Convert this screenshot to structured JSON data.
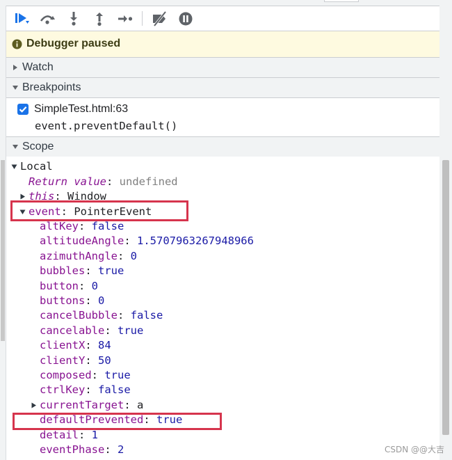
{
  "toolbar": {
    "buttons": [
      {
        "name": "resume-icon",
        "color": "#1a73e8"
      },
      {
        "name": "step-over-icon",
        "color": "#5f6368"
      },
      {
        "name": "step-into-icon",
        "color": "#5f6368"
      },
      {
        "name": "step-out-icon",
        "color": "#5f6368"
      },
      {
        "name": "step-icon",
        "color": "#5f6368"
      },
      {
        "name": "deactivate-breakpoints-icon",
        "color": "#5f6368"
      },
      {
        "name": "pause-on-exceptions-icon",
        "color": "#5f6368"
      }
    ]
  },
  "banner": {
    "text": "Debugger paused",
    "icon": "info-icon",
    "background": "#fefae0"
  },
  "sections": {
    "watch": {
      "label": "Watch",
      "expanded": false
    },
    "breakpoints": {
      "label": "Breakpoints",
      "expanded": true
    },
    "scope": {
      "label": "Scope",
      "expanded": true
    }
  },
  "breakpoint": {
    "checked": true,
    "location": "SimpleTest.html:63",
    "code": "event.preventDefault()"
  },
  "scope": {
    "local_label": "Local",
    "return_value": {
      "key": "Return value",
      "value": "undefined"
    },
    "this_entry": {
      "key": "this",
      "value": "Window"
    },
    "event_entry": {
      "key": "event",
      "value": "PointerEvent"
    },
    "properties": [
      {
        "key": "altKey",
        "value": "false",
        "type": "bool"
      },
      {
        "key": "altitudeAngle",
        "value": "1.5707963267948966",
        "type": "num"
      },
      {
        "key": "azimuthAngle",
        "value": "0",
        "type": "num"
      },
      {
        "key": "bubbles",
        "value": "true",
        "type": "bool"
      },
      {
        "key": "button",
        "value": "0",
        "type": "num"
      },
      {
        "key": "buttons",
        "value": "0",
        "type": "num"
      },
      {
        "key": "cancelBubble",
        "value": "false",
        "type": "bool"
      },
      {
        "key": "cancelable",
        "value": "true",
        "type": "bool"
      },
      {
        "key": "clientX",
        "value": "84",
        "type": "num"
      },
      {
        "key": "clientY",
        "value": "50",
        "type": "num"
      },
      {
        "key": "composed",
        "value": "true",
        "type": "bool"
      },
      {
        "key": "ctrlKey",
        "value": "false",
        "type": "bool"
      },
      {
        "key": "currentTarget",
        "value": "a",
        "type": "obj",
        "expandable": true
      },
      {
        "key": "defaultPrevented",
        "value": "true",
        "type": "bool"
      },
      {
        "key": "detail",
        "value": "1",
        "type": "num"
      },
      {
        "key": "eventPhase",
        "value": "2",
        "type": "num"
      }
    ],
    "separator": ": "
  },
  "highlight_color": "#d6344d",
  "watermark": "CSDN @@大吉"
}
